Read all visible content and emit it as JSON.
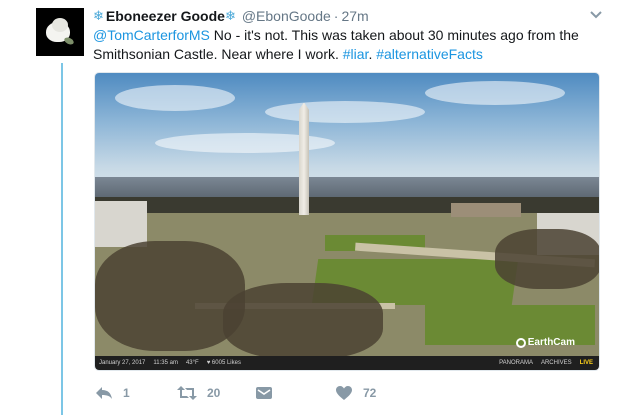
{
  "tweet": {
    "author_name": "Eboneezer Goode",
    "author_handle": "@EbonGoode",
    "separator": "·",
    "timestamp": "27m",
    "text_mention": "@TomCarterforMS",
    "text_body": " No - it's not.  This was taken about 30 minutes ago from the Smithsonian Castle. Near where I work. ",
    "hashtag_1": "#liar",
    "hashtag_sep": ". ",
    "hashtag_2": "#alternativeFacts"
  },
  "media": {
    "watermark": "EarthCam",
    "bar_date": "January 27, 2017",
    "bar_time": "11:35 am",
    "bar_temp": "43°F",
    "bar_likes": "♥ 6005 Likes",
    "bar_panorama": "PANORAMA",
    "bar_archives": "ARCHIVES",
    "bar_live": "LIVE"
  },
  "actions": {
    "reply_count": "1",
    "retweet_count": "20",
    "like_count": "72"
  },
  "icons": {
    "caret": "chevron-down-icon",
    "reply": "reply-icon",
    "retweet": "retweet-icon",
    "dm": "envelope-icon",
    "like": "heart-icon",
    "decoration": "snowflake-icon"
  },
  "colors": {
    "link": "#1b95e0",
    "muted": "#657786",
    "thread_line": "#7cc6e6",
    "live": "#ffd21a"
  }
}
